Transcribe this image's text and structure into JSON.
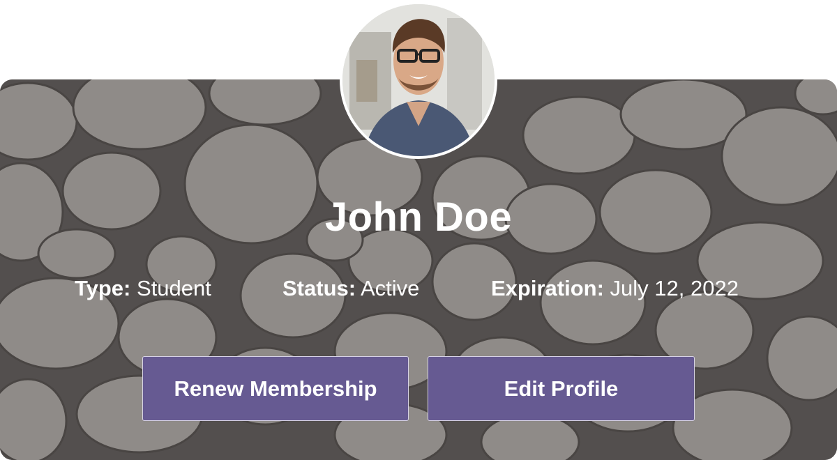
{
  "profile": {
    "name": "John Doe",
    "type_label": "Type:",
    "type_value": "Student",
    "status_label": "Status:",
    "status_value": "Active",
    "expiration_label": "Expiration:",
    "expiration_value": "July 12, 2022"
  },
  "actions": {
    "renew_label": "Renew Membership",
    "edit_label": "Edit Profile"
  },
  "colors": {
    "button_bg": "#665a92",
    "text": "#ffffff",
    "background": "#7a7570"
  },
  "icons": {
    "avatar": "profile-photo"
  }
}
